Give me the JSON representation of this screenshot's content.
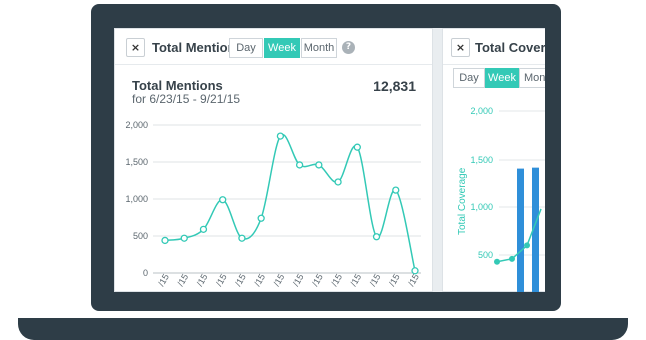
{
  "left_panel": {
    "close_label": "×",
    "title": "Total Mentions",
    "periods": [
      "Day",
      "Week",
      "Month"
    ],
    "active_period": "Week",
    "help_label": "?",
    "stat_title": "Total Mentions",
    "stat_range": "for 6/23/15 - 9/21/15",
    "stat_total": "12,831"
  },
  "right_panel": {
    "close_label": "×",
    "title": "Total Coverage",
    "periods": [
      "Day",
      "Week",
      "Mont"
    ],
    "active_period": "Week"
  },
  "colors": {
    "accent": "#33c9b6",
    "bar": "#2f8fd9",
    "frame": "#2e3d47"
  },
  "chart_data": [
    {
      "type": "line",
      "ylim": [
        0,
        2000
      ],
      "y_ticks": [
        "0",
        "500",
        "1,000",
        "1,500",
        "2,000"
      ],
      "x_tick_labels": [
        "/15",
        "/15",
        "/15",
        "/15",
        "/15",
        "/15",
        "/15",
        "/15",
        "/15",
        "/15",
        "/15",
        "/15",
        "/15",
        "/15"
      ],
      "values": [
        440,
        470,
        590,
        990,
        470,
        740,
        1850,
        1460,
        1460,
        1230,
        1700,
        490,
        1120,
        30
      ]
    },
    {
      "type": "bar",
      "ylabel": "Total Coverage",
      "ylim": [
        0,
        2500
      ],
      "y_ticks": [
        "500",
        "1,000",
        "1,500",
        "2,000"
      ],
      "bars": [
        90,
        1400,
        1410,
        1400
      ],
      "line_values": [
        430,
        460,
        600,
        980
      ]
    }
  ]
}
